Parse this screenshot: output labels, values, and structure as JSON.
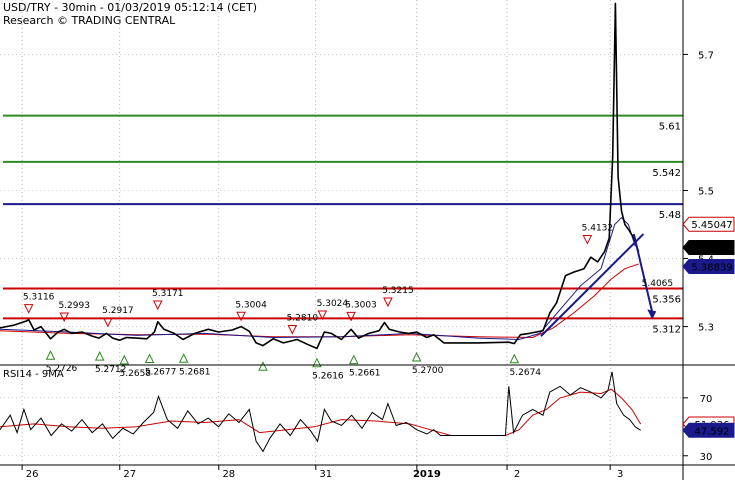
{
  "header": {
    "title": "USD/TRY - 30min - 01/03/2019 05:12:14 (CET)",
    "subtitle": "Research © TRADING CENTRAL"
  },
  "indicator_title": "RSI14 - 9MA",
  "colors": {
    "resistance_high": "#2e8b22",
    "pivot": "#1a1a8c",
    "support": "#cc0000",
    "price": "#000000",
    "ma_fast": "#1a1a8c",
    "ma_slow": "#cc0000",
    "rsi": "#000000",
    "rsi_ma": "#cc0000",
    "arrow": "#1a1a8c",
    "label_current": "#000000",
    "label_ma": "#1a1a8c",
    "label_red": "#cc0000"
  },
  "chart_data": {
    "type": "line",
    "main": {
      "ylim": [
        5.245,
        5.78
      ],
      "yticks": [
        5.3,
        5.4,
        5.5,
        5.7
      ],
      "ytick_labels": [
        "5.3",
        "5.4",
        "5.5",
        "5.7"
      ],
      "xlim": [
        0,
        100
      ],
      "xticks": [
        {
          "x": 4.7,
          "label": "26"
        },
        {
          "x": 19.0,
          "label": "27"
        },
        {
          "x": 33.5,
          "label": "28"
        },
        {
          "x": 47.7,
          "label": "31"
        },
        {
          "x": 62.5,
          "label": "2019"
        },
        {
          "x": 75.7,
          "label": "2"
        },
        {
          "x": 90.8,
          "label": "3"
        }
      ],
      "levels": [
        {
          "value": 5.61,
          "label": "5.61",
          "role": "resistance_high"
        },
        {
          "value": 5.542,
          "label": "5.542",
          "role": "resistance_high"
        },
        {
          "value": 5.48,
          "label": "5.48",
          "role": "pivot"
        },
        {
          "value": 5.356,
          "label": "5.356",
          "role": "support"
        },
        {
          "value": 5.312,
          "label": "5.312",
          "role": "support"
        }
      ],
      "axis_tags": [
        {
          "value": 5.45047,
          "label": "5.45047",
          "style": "red"
        },
        {
          "value": 5.4162,
          "label": "5.4162",
          "style": "black"
        },
        {
          "value": 5.38839,
          "label": "5.38839",
          "style": "blue"
        }
      ],
      "price": [
        [
          0,
          5.298
        ],
        [
          2,
          5.302
        ],
        [
          3.8,
          5.308
        ],
        [
          4.2,
          5.31
        ],
        [
          5,
          5.295
        ],
        [
          6,
          5.3
        ],
        [
          7.4,
          5.282
        ],
        [
          8.5,
          5.292
        ],
        [
          9.4,
          5.296
        ],
        [
          10.5,
          5.29
        ],
        [
          12,
          5.292
        ],
        [
          13.5,
          5.286
        ],
        [
          14.5,
          5.283
        ],
        [
          15.6,
          5.29
        ],
        [
          16.5,
          5.283
        ],
        [
          17.5,
          5.28
        ],
        [
          18.5,
          5.284
        ],
        [
          20,
          5.283
        ],
        [
          21.5,
          5.282
        ],
        [
          22.6,
          5.292
        ],
        [
          23.1,
          5.307
        ],
        [
          24,
          5.296
        ],
        [
          25.5,
          5.29
        ],
        [
          26.8,
          5.281
        ],
        [
          28.5,
          5.29
        ],
        [
          30.5,
          5.296
        ],
        [
          32,
          5.292
        ],
        [
          34,
          5.295
        ],
        [
          35.3,
          5.3
        ],
        [
          36.5,
          5.293
        ],
        [
          37.5,
          5.276
        ],
        [
          38.5,
          5.272
        ],
        [
          40,
          5.282
        ],
        [
          41.5,
          5.276
        ],
        [
          43.5,
          5.281
        ],
        [
          45,
          5.274
        ],
        [
          46.4,
          5.268
        ],
        [
          47.5,
          5.292
        ],
        [
          48.5,
          5.29
        ],
        [
          50,
          5.281
        ],
        [
          51.4,
          5.296
        ],
        [
          52.5,
          5.283
        ],
        [
          54,
          5.29
        ],
        [
          55.5,
          5.294
        ],
        [
          56.3,
          5.306
        ],
        [
          57,
          5.296
        ],
        [
          58.5,
          5.292
        ],
        [
          59.8,
          5.29
        ],
        [
          61,
          5.292
        ],
        [
          62.5,
          5.284
        ],
        [
          63.5,
          5.288
        ],
        [
          65,
          5.276
        ],
        [
          70,
          5.276
        ],
        [
          74.5,
          5.277
        ],
        [
          75.3,
          5.275
        ],
        [
          76.2,
          5.288
        ],
        [
          77.5,
          5.29
        ],
        [
          79.5,
          5.294
        ],
        [
          80.5,
          5.32
        ],
        [
          81.5,
          5.335
        ],
        [
          82.8,
          5.375
        ],
        [
          84,
          5.38
        ],
        [
          85.5,
          5.385
        ],
        [
          86.5,
          5.402
        ],
        [
          87.5,
          5.395
        ],
        [
          88.5,
          5.41
        ],
        [
          89.2,
          5.43
        ],
        [
          89.7,
          5.55
        ],
        [
          90.1,
          5.775
        ],
        [
          90.5,
          5.52
        ],
        [
          91,
          5.47
        ],
        [
          91.5,
          5.45
        ],
        [
          92.2,
          5.44
        ],
        [
          92.8,
          5.43
        ],
        [
          93.5,
          5.41
        ]
      ],
      "ma_fast": [
        [
          0,
          5.296
        ],
        [
          10,
          5.292
        ],
        [
          20,
          5.287
        ],
        [
          30,
          5.29
        ],
        [
          40,
          5.284
        ],
        [
          50,
          5.285
        ],
        [
          60,
          5.29
        ],
        [
          70,
          5.283
        ],
        [
          76,
          5.281
        ],
        [
          79,
          5.29
        ],
        [
          82,
          5.325
        ],
        [
          85,
          5.36
        ],
        [
          88,
          5.385
        ],
        [
          90,
          5.45
        ],
        [
          91,
          5.46
        ],
        [
          92,
          5.45
        ],
        [
          93,
          5.418
        ]
      ],
      "ma_slow": [
        [
          0,
          5.294
        ],
        [
          10,
          5.29
        ],
        [
          20,
          5.288
        ],
        [
          30,
          5.289
        ],
        [
          40,
          5.285
        ],
        [
          50,
          5.285
        ],
        [
          60,
          5.288
        ],
        [
          70,
          5.285
        ],
        [
          78,
          5.284
        ],
        [
          81,
          5.298
        ],
        [
          84,
          5.32
        ],
        [
          87,
          5.345
        ],
        [
          89.5,
          5.37
        ],
        [
          91.5,
          5.385
        ],
        [
          93.5,
          5.392
        ]
      ],
      "trendline": [
        [
          79.2,
          5.286
        ],
        [
          94.2,
          5.436
        ]
      ],
      "projection": [
        [
          92.8,
          5.436
        ],
        [
          95.5,
          5.312
        ]
      ],
      "markers": [
        {
          "x": 4.2,
          "y": 5.3116,
          "dir": "down",
          "label": "5.3116"
        },
        {
          "x": 9.4,
          "y": 5.2993,
          "dir": "down",
          "label": "5.2993"
        },
        {
          "x": 15.8,
          "y": 5.2917,
          "dir": "down",
          "label": "5.2917"
        },
        {
          "x": 23.1,
          "y": 5.3171,
          "dir": "down",
          "label": "5.3171"
        },
        {
          "x": 35.3,
          "y": 5.3004,
          "dir": "down",
          "label": "5.3004"
        },
        {
          "x": 42.8,
          "y": 5.281,
          "dir": "down",
          "label": "5.2810"
        },
        {
          "x": 47.2,
          "y": 5.3024,
          "dir": "down",
          "label": "5.3024"
        },
        {
          "x": 51.4,
          "y": 5.3003,
          "dir": "down",
          "label": "5.3003"
        },
        {
          "x": 56.8,
          "y": 5.3215,
          "dir": "down",
          "label": "5.3215"
        },
        {
          "x": 86.0,
          "y": 5.4132,
          "dir": "down",
          "label": "5.4132"
        },
        {
          "x": 89.9,
          "y": 5.776,
          "dir": "down",
          "label": ""
        },
        {
          "x": 7.4,
          "y": 5.2726,
          "dir": "up",
          "label": "5.2726"
        },
        {
          "x": 14.6,
          "y": 5.2712,
          "dir": "up",
          "label": "5.2712"
        },
        {
          "x": 18.2,
          "y": 5.2658,
          "dir": "up",
          "label": "5.2658"
        },
        {
          "x": 21.9,
          "y": 5.2677,
          "dir": "up",
          "label": "5.2677"
        },
        {
          "x": 26.9,
          "y": 5.2681,
          "dir": "up",
          "label": "5.2681"
        },
        {
          "x": 38.5,
          "y": 5.2564,
          "dir": "up",
          "label": ""
        },
        {
          "x": 46.4,
          "y": 5.2616,
          "dir": "up",
          "label": "5.2616"
        },
        {
          "x": 51.8,
          "y": 5.2661,
          "dir": "up",
          "label": "5.2661"
        },
        {
          "x": 61.0,
          "y": 5.27,
          "dir": "up",
          "label": "5.2700"
        },
        {
          "x": 75.3,
          "y": 5.2674,
          "dir": "up",
          "label": "5.2674"
        }
      ],
      "annotations": [
        {
          "x": 94.2,
          "y": 5.376,
          "label": "5.4065"
        }
      ]
    },
    "rsi": {
      "title": "RSI14 - 9MA",
      "ylim": [
        25,
        92
      ],
      "yticks": [
        30,
        70
      ],
      "ytick_labels": [
        "30",
        "70"
      ],
      "axis_tags": [
        {
          "value": 51.936,
          "label": "51.936",
          "style": "red"
        },
        {
          "value": 47.592,
          "label": "47.592",
          "style": "blue"
        }
      ],
      "rsi": [
        [
          0,
          48
        ],
        [
          1.5,
          58
        ],
        [
          2.5,
          46
        ],
        [
          3.5,
          62
        ],
        [
          4.5,
          48
        ],
        [
          6,
          56
        ],
        [
          7.5,
          44
        ],
        [
          9,
          52
        ],
        [
          10.5,
          47
        ],
        [
          12,
          55
        ],
        [
          13.5,
          46
        ],
        [
          15,
          52
        ],
        [
          16.5,
          42
        ],
        [
          18,
          49
        ],
        [
          19.5,
          45
        ],
        [
          21,
          53
        ],
        [
          22.5,
          60
        ],
        [
          23.2,
          71
        ],
        [
          24.5,
          55
        ],
        [
          26,
          49
        ],
        [
          27.5,
          61
        ],
        [
          29,
          52
        ],
        [
          30.5,
          56
        ],
        [
          32,
          50
        ],
        [
          33.5,
          59
        ],
        [
          35,
          53
        ],
        [
          36.5,
          62
        ],
        [
          37.5,
          40
        ],
        [
          38.5,
          33
        ],
        [
          39.5,
          42
        ],
        [
          41,
          52
        ],
        [
          42.5,
          44
        ],
        [
          44,
          55
        ],
        [
          45.5,
          47
        ],
        [
          46.5,
          40
        ],
        [
          47.5,
          62
        ],
        [
          48.5,
          54
        ],
        [
          50,
          51
        ],
        [
          51.5,
          58
        ],
        [
          53,
          49
        ],
        [
          54.5,
          60
        ],
        [
          56,
          55
        ],
        [
          56.8,
          66
        ],
        [
          58,
          51
        ],
        [
          59.5,
          53
        ],
        [
          61,
          48
        ],
        [
          62.5,
          45
        ],
        [
          63.5,
          48
        ],
        [
          64.5,
          44
        ],
        [
          66,
          44
        ],
        [
          70,
          44
        ],
        [
          74,
          44
        ],
        [
          74.5,
          78
        ],
        [
          75.2,
          46
        ],
        [
          76.5,
          58
        ],
        [
          78,
          62
        ],
        [
          79.5,
          58
        ],
        [
          80.5,
          74
        ],
        [
          82,
          78
        ],
        [
          83.5,
          72
        ],
        [
          85,
          77
        ],
        [
          86.5,
          74
        ],
        [
          88,
          70
        ],
        [
          89,
          75
        ],
        [
          89.6,
          88
        ],
        [
          90.3,
          66
        ],
        [
          91.3,
          58
        ],
        [
          92.2,
          55
        ],
        [
          93,
          50
        ],
        [
          93.8,
          47.6
        ]
      ],
      "rsi_ma": [
        [
          0,
          50
        ],
        [
          5,
          52
        ],
        [
          10,
          50
        ],
        [
          15,
          49
        ],
        [
          20,
          50
        ],
        [
          25,
          54
        ],
        [
          30,
          53
        ],
        [
          35,
          55
        ],
        [
          38,
          46
        ],
        [
          42,
          48
        ],
        [
          46,
          50
        ],
        [
          50,
          55
        ],
        [
          55,
          54
        ],
        [
          60,
          52
        ],
        [
          63,
          48
        ],
        [
          66,
          44
        ],
        [
          74,
          44
        ],
        [
          76,
          48
        ],
        [
          78,
          58
        ],
        [
          80,
          62
        ],
        [
          82,
          70
        ],
        [
          85,
          74
        ],
        [
          88,
          73
        ],
        [
          89.5,
          76
        ],
        [
          91,
          70
        ],
        [
          92.5,
          62
        ],
        [
          93.8,
          51.9
        ]
      ]
    }
  }
}
